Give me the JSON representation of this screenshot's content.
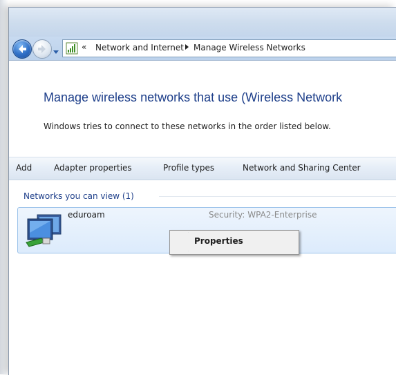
{
  "navigation": {
    "back_icon": "back-arrow-icon",
    "forward_icon": "forward-arrow-icon",
    "recent_icon": "dropdown-triangle-icon"
  },
  "address_bar": {
    "icon": "network-signal-bars-icon",
    "overflow_glyph": "«",
    "breadcrumbs": [
      "Network and Internet",
      "Manage Wireless Networks"
    ]
  },
  "main": {
    "heading": "Manage wireless networks that use (Wireless Network",
    "description": "Windows tries to connect to these networks in the order listed below."
  },
  "toolbar": {
    "add_label": "Add",
    "adapter_properties_label": "Adapter properties",
    "profile_types_label": "Profile types",
    "network_sharing_center_label": "Network and Sharing Center"
  },
  "networks": {
    "group_header": "Networks you can view (1)",
    "items": [
      {
        "name": "eduroam",
        "security": "Security: WPA2-Enterprise",
        "icon": "wireless-network-profile-icon"
      }
    ]
  },
  "context_menu": {
    "items": [
      {
        "label": "Properties"
      }
    ]
  },
  "colors": {
    "heading": "#1e3f8a",
    "selection_bg": "#dcebfc",
    "selection_border": "#9cc3ea",
    "security_text": "#8a8a8a"
  }
}
